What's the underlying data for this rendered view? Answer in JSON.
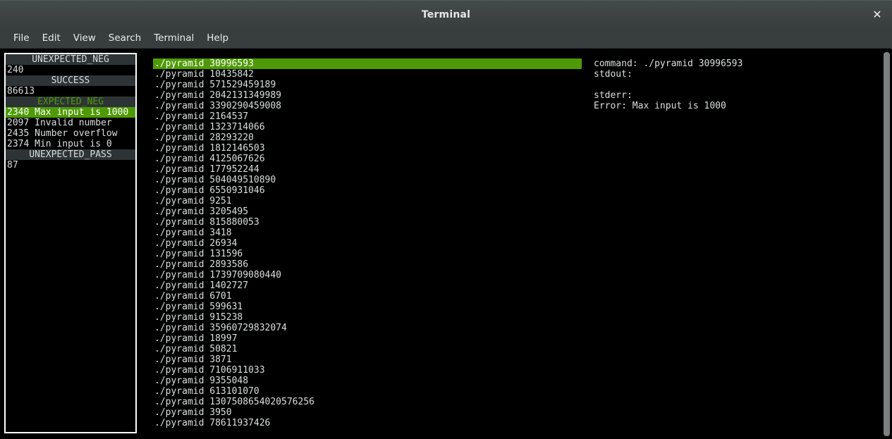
{
  "window": {
    "title": "Terminal",
    "close_label": "✕"
  },
  "menubar": {
    "items": [
      {
        "label": "File"
      },
      {
        "label": "Edit"
      },
      {
        "label": "View"
      },
      {
        "label": "Search"
      },
      {
        "label": "Terminal"
      },
      {
        "label": "Help"
      }
    ]
  },
  "sidebar": {
    "groups": [
      {
        "header": "UNEXPECTED_NEG",
        "header_color": "#d8dcdc",
        "rows": [
          {
            "text": "240",
            "selected": false
          }
        ]
      },
      {
        "header": "SUCCESS",
        "header_color": "#d8dcdc",
        "rows": [
          {
            "text": "86613",
            "selected": false
          }
        ]
      },
      {
        "header": "EXPECTED_NEG",
        "header_color": "#4e9a06",
        "rows": [
          {
            "text": "2340 Max input is 1000",
            "selected": true
          },
          {
            "text": "2097 Invalid number",
            "selected": false
          },
          {
            "text": "2435 Number overflow",
            "selected": false
          },
          {
            "text": "2374 Min input is 0",
            "selected": false
          }
        ]
      },
      {
        "header": "UNEXPECTED_PASS",
        "header_color": "#d8dcdc",
        "rows": [
          {
            "text": "87",
            "selected": false
          }
        ]
      }
    ]
  },
  "command_list": {
    "rows": [
      {
        "text": "./pyramid 30996593",
        "selected": true
      },
      {
        "text": "./pyramid 10435842",
        "selected": false
      },
      {
        "text": "./pyramid 571529459189",
        "selected": false
      },
      {
        "text": "./pyramid 2042131349989",
        "selected": false
      },
      {
        "text": "./pyramid 3390290459008",
        "selected": false
      },
      {
        "text": "./pyramid 2164537",
        "selected": false
      },
      {
        "text": "./pyramid 1323714066",
        "selected": false
      },
      {
        "text": "./pyramid 28293220",
        "selected": false
      },
      {
        "text": "./pyramid 1812146503",
        "selected": false
      },
      {
        "text": "./pyramid 4125067626",
        "selected": false
      },
      {
        "text": "./pyramid 177952244",
        "selected": false
      },
      {
        "text": "./pyramid 504049510890",
        "selected": false
      },
      {
        "text": "./pyramid 6550931046",
        "selected": false
      },
      {
        "text": "./pyramid 9251",
        "selected": false
      },
      {
        "text": "./pyramid 3205495",
        "selected": false
      },
      {
        "text": "./pyramid 815880053",
        "selected": false
      },
      {
        "text": "./pyramid 3418",
        "selected": false
      },
      {
        "text": "./pyramid 26934",
        "selected": false
      },
      {
        "text": "./pyramid 131596",
        "selected": false
      },
      {
        "text": "./pyramid 2893586",
        "selected": false
      },
      {
        "text": "./pyramid 1739709080440",
        "selected": false
      },
      {
        "text": "./pyramid 1402727",
        "selected": false
      },
      {
        "text": "./pyramid 6701",
        "selected": false
      },
      {
        "text": "./pyramid 599631",
        "selected": false
      },
      {
        "text": "./pyramid 915238",
        "selected": false
      },
      {
        "text": "./pyramid 35960729832074",
        "selected": false
      },
      {
        "text": "./pyramid 18997",
        "selected": false
      },
      {
        "text": "./pyramid 50821",
        "selected": false
      },
      {
        "text": "./pyramid 3871",
        "selected": false
      },
      {
        "text": "./pyramid 7106911033",
        "selected": false
      },
      {
        "text": "./pyramid 9355048",
        "selected": false
      },
      {
        "text": "./pyramid 613101070",
        "selected": false
      },
      {
        "text": "./pyramid 1307508654020576256",
        "selected": false
      },
      {
        "text": "./pyramid 3950",
        "selected": false
      },
      {
        "text": "./pyramid 78611937426",
        "selected": false
      }
    ]
  },
  "detail": {
    "rows": [
      {
        "text": "command: ./pyramid 30996593"
      },
      {
        "text": "stdout:"
      },
      {
        "text": ""
      },
      {
        "text": "stderr:"
      },
      {
        "text": "Error: Max input is 1000"
      }
    ]
  },
  "colors": {
    "highlight_green": "#4e9a06",
    "header_gray": "#2e3436",
    "terminal_bg": "#000000",
    "terminal_fg": "#dcdfdf",
    "titlebar": "#3f4545"
  }
}
